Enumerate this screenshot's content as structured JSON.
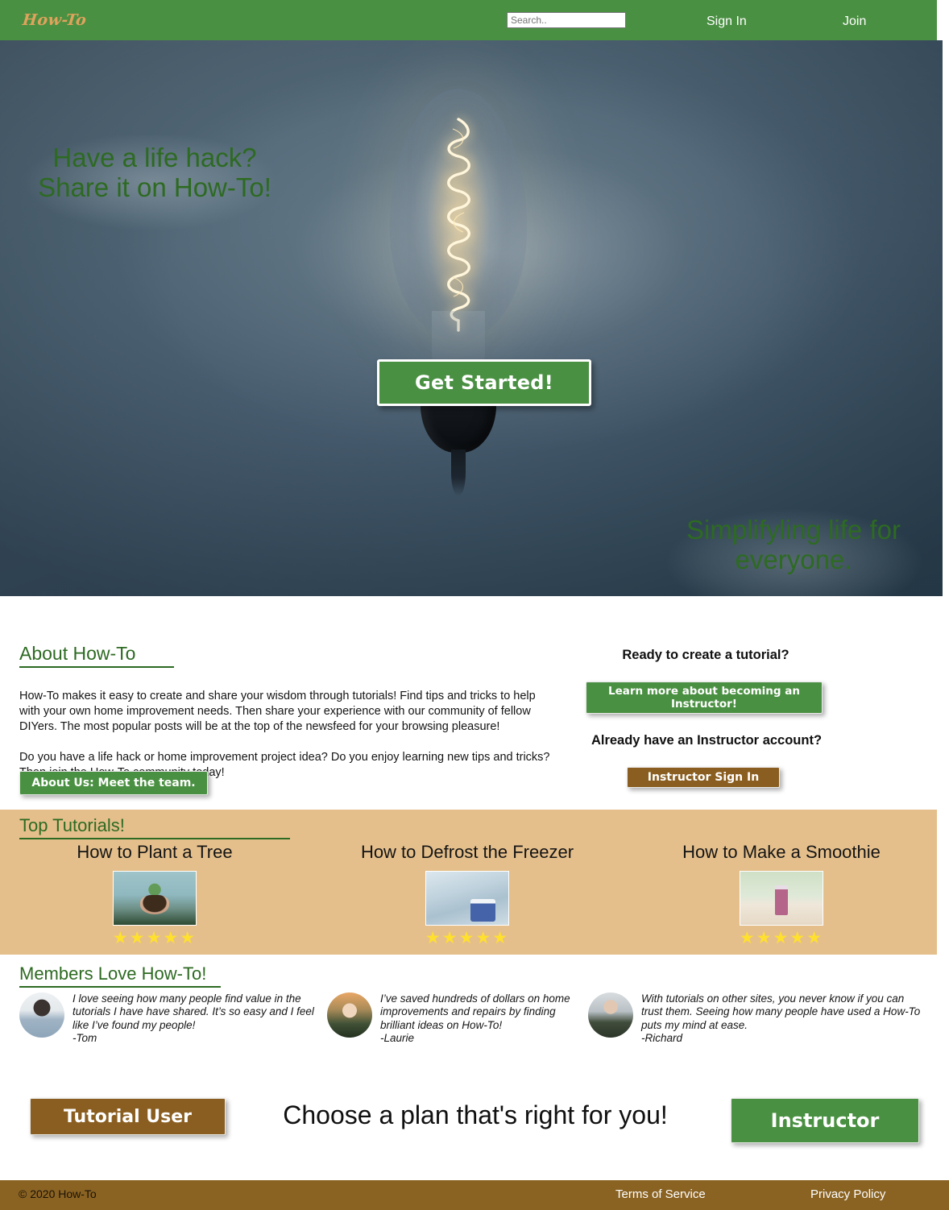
{
  "nav": {
    "logo": "How-To",
    "search_placeholder": "Search..",
    "search_value": "",
    "sign_in": "Sign In",
    "join": "Join"
  },
  "hero": {
    "headline": "Have a life hack? Share it on How-To!",
    "subhead": "Simplifyling life for everyone.",
    "cta": "Get Started!",
    "bg_color": "#4f6575",
    "accent_green": "#4a9042",
    "text_green": "#2d6a22"
  },
  "about": {
    "title": "About How-To",
    "paragraph1": "How-To makes it easy to create and share your wisdom through tutorials! Find tips and tricks to help with your own home improvement needs. Then share your experience with our community of fellow DIYers. The most popular posts will be at the top of the newsfeed for your browsing pleasure!",
    "paragraph2": "Do you have a life hack or home improvement project idea? Do you enjoy learning new tips and tricks? Then join the How-To community today!",
    "about_button": "About Us: Meet the team."
  },
  "instructor_cta": {
    "ready_heading": "Ready to create a tutorial?",
    "learn_more_button": "Learn more about becoming an Instructor!",
    "already_heading": "Already have an Instructor account?",
    "sign_in_button": "Instructor Sign In"
  },
  "tutorials": {
    "title": "Top Tutorials!",
    "bg_color": "#e4bf8c",
    "items": [
      {
        "name": "How to Plant a Tree",
        "stars": "★★★★★",
        "rating": 5,
        "thumb": "tree-thumbnail"
      },
      {
        "name": "How to Defrost the Freezer",
        "stars": "★★★★★",
        "rating": 5,
        "thumb": "freezer-thumbnail"
      },
      {
        "name": "How to Make a Smoothie",
        "stars": "★★★★★",
        "rating": 5,
        "thumb": "smoothie-thumbnail"
      }
    ]
  },
  "members": {
    "title": "Members Love How-To!",
    "testimonials": [
      {
        "quote": "I love seeing how many people find value in the tutorials I have have shared. It’s so easy and I feel like I’ve found my people!",
        "author": "-Tom",
        "avatar": "tom-avatar"
      },
      {
        "quote": "I’ve saved hundreds of dollars on home improvements and repairs by finding brilliant ideas on How-To!",
        "author": "-Laurie",
        "avatar": "laurie-avatar"
      },
      {
        "quote": "With tutorials on other sites, you never know if you can trust them. Seeing how many people have used a How-To puts my mind at ease.",
        "author": "-Richard",
        "avatar": "richard-avatar"
      }
    ]
  },
  "plan": {
    "tutorial_user_button": "Tutorial User",
    "heading": "Choose a plan that's right for you!",
    "instructor_button": "Instructor"
  },
  "footer": {
    "copyright": "© 2020 How-To",
    "terms": "Terms of Service",
    "privacy": "Privacy Policy",
    "bg_color": "#8a6323"
  }
}
